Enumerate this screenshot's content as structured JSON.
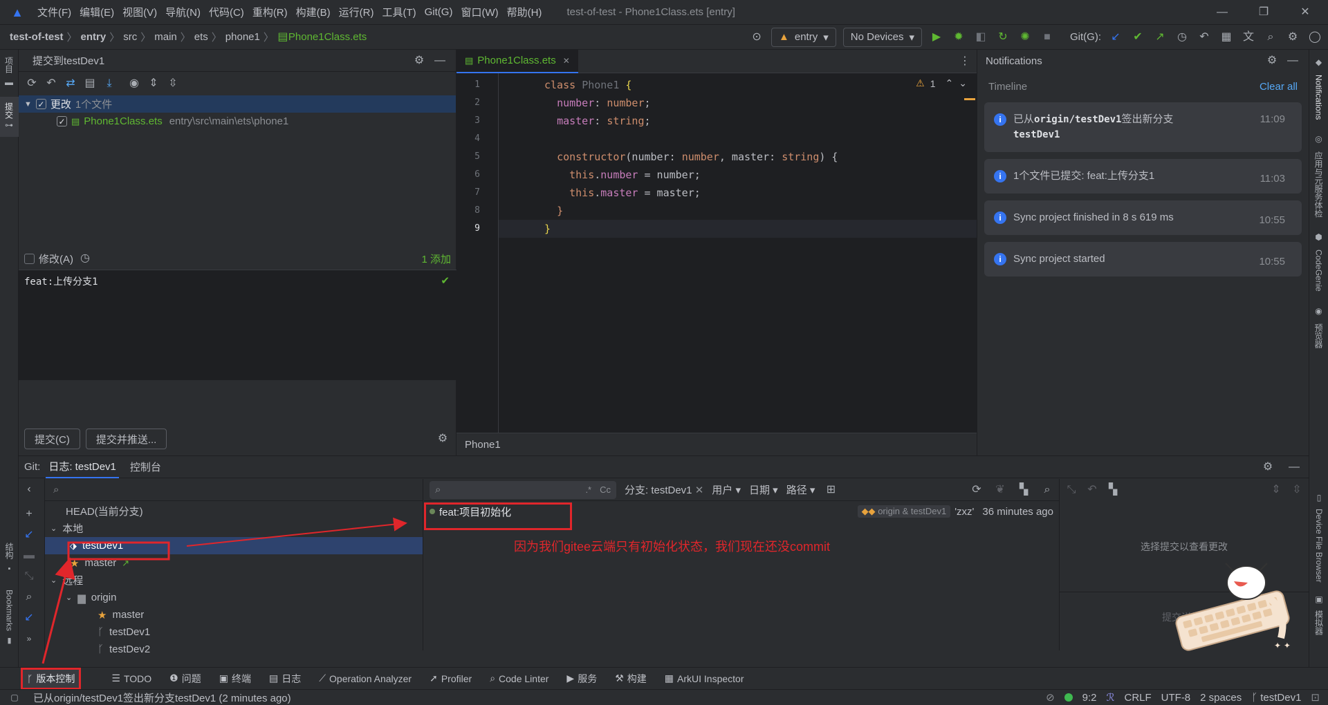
{
  "titlebar": {
    "menus": [
      "文件(F)",
      "编辑(E)",
      "视图(V)",
      "导航(N)",
      "代码(C)",
      "重构(R)",
      "构建(B)",
      "运行(R)",
      "工具(T)",
      "Git(G)",
      "窗口(W)",
      "帮助(H)"
    ],
    "title": "test-of-test - Phone1Class.ets [entry]"
  },
  "breadcrumb": [
    "test-of-test",
    "entry",
    "src",
    "main",
    "ets",
    "phone1",
    "Phone1Class.ets"
  ],
  "navbar": {
    "module": "entry",
    "devices": "No Devices",
    "git_label": "Git(G):"
  },
  "leftstrip": {
    "project": "项目",
    "commit": "提交",
    "structure": "结构",
    "bookmarks": "Bookmarks"
  },
  "commit": {
    "header": "提交到testDev1",
    "changes_label": "更改",
    "changes_count": "1个文件",
    "file_name": "Phone1Class.ets",
    "file_path": "entry\\src\\main\\ets\\phone1",
    "amend_label": "修改(A)",
    "added": "1 添加",
    "message": "feat:上传分支1",
    "commit_btn": "提交(C)",
    "commit_push_btn": "提交并推送..."
  },
  "editor": {
    "tab": "Phone1Class.ets",
    "warning_count": "1",
    "lines": [
      "1",
      "2",
      "3",
      "4",
      "5",
      "6",
      "7",
      "8",
      "9"
    ],
    "footer": "Phone1"
  },
  "notifications": {
    "title": "Notifications",
    "timeline": "Timeline",
    "clear": "Clear all",
    "items": [
      {
        "text1": "已从",
        "bold1": "origin/testDev1",
        "text2": "签出新分支",
        "bold2": "testDev1",
        "time": "11:09"
      },
      {
        "text": "1个文件已提交: feat:上传分支1",
        "time": "11:03"
      },
      {
        "text": "Sync project finished in 8 s 619 ms",
        "time": "10:55"
      },
      {
        "text": "Sync project started",
        "time": "10:55"
      }
    ]
  },
  "rightstrip": {
    "notifications": "Notifications",
    "app_service": "应用与元服务体检",
    "codegenie": "CodeGenie",
    "preview": "预览器",
    "device_file": "Device File Browser",
    "emulator": "模拟器"
  },
  "git": {
    "tab_git": "Git:",
    "tab_log": "日志: testDev1",
    "tab_console": "控制台",
    "head": "HEAD(当前分支)",
    "local": "本地",
    "local_branches": [
      "testDev1",
      "master"
    ],
    "remote": "远程",
    "origin": "origin",
    "remote_branches": [
      "master",
      "testDev1",
      "testDev2"
    ],
    "filter_branch": "分支: testDev1",
    "filter_user": "用户",
    "filter_date": "日期",
    "filter_path": "路径",
    "commit_msg": "feat:项目初始化",
    "commit_refs": "origin & testDev1",
    "commit_author": "'zxz'",
    "commit_time": "36 minutes ago",
    "annotation": "因为我们gitee云端只有初始化状态，我们现在还没commit",
    "select_hint": "选择提交以查看更改",
    "detail_hint": "提交详细信息"
  },
  "bottombar": [
    "版本控制",
    "TODO",
    "问题",
    "终端",
    "日志",
    "Operation Analyzer",
    "Profiler",
    "Code Linter",
    "服务",
    "构建",
    "ArkUI Inspector"
  ],
  "status": {
    "message": "已从origin/testDev1签出新分支testDev1 (2 minutes ago)",
    "position": "9:2",
    "line_ending": "CRLF",
    "encoding": "UTF-8",
    "indent": "2 spaces",
    "branch": "testDev1"
  },
  "colors": {
    "accent": "#3574f0",
    "red": "#e0262b",
    "green": "#5fb832",
    "selected": "#2e436e"
  }
}
